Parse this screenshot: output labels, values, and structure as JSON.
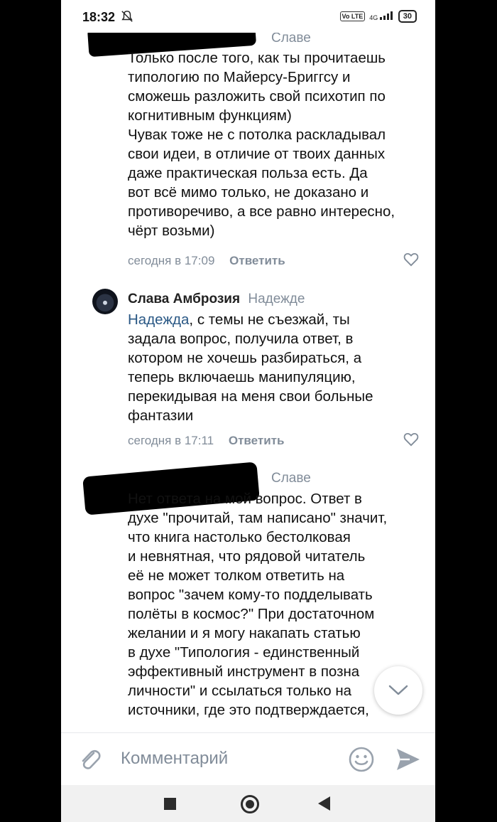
{
  "status_bar": {
    "time": "18:32",
    "volte": "Vo LTE",
    "network": "4G",
    "battery": "30"
  },
  "comments": [
    {
      "author": "",
      "reply_to": "Славе",
      "lines": [
        "Только после того, как ты прочитаешь",
        "типологию по Майерсу-Бриггсу и",
        "сможешь разложить свой психотип по",
        "когнитивным функциям)",
        "Чувак тоже не с потолка раскладывал",
        "свои идеи, в отличие от твоих данных",
        "даже практическая польза есть. Да",
        "вот всё мимо только, не доказано и",
        "противоречиво, а все равно интересно,",
        "чёрт возьми)"
      ],
      "time": "сегодня в 17:09",
      "reply_label": "Ответить"
    },
    {
      "author": "Слава Амброзия",
      "reply_to": "Надежде",
      "mention": "Надежда",
      "first_line_rest": ", с темы не съезжай, ты",
      "lines": [
        "задала вопрос, получила ответ, в",
        "котором не хочешь разбираться, а",
        "теперь включаешь манипуляцию,",
        "перекидывая на меня свои больные",
        "фантазии"
      ],
      "time": "сегодня в 17:11",
      "reply_label": "Ответить"
    },
    {
      "author": "",
      "reply_to": "Славе",
      "lines": [
        "Нет ответа на мой вопрос. Ответ в",
        "духе \"прочитай, там написано\" значит,",
        "что книга настолько бестолковая",
        "и невнятная, что рядовой читатель",
        "её не может толком ответить на",
        "вопрос \"зачем кому-то подделывать",
        "полёты в космос?\" При достаточном",
        "желании и я могу накапать статью",
        "в духе \"Типология - единственный",
        "эффективный инструмент в позна",
        "личности\" и ссылаться только на",
        "источники, где это подтверждается,"
      ]
    }
  ],
  "composer": {
    "placeholder": "Комментарий"
  },
  "colors": {
    "link": "#2a5885",
    "meta": "#818c99",
    "text": "#111111"
  },
  "icons": [
    "mute-bell-icon",
    "heart-icon",
    "chevron-down-icon",
    "paperclip-icon",
    "smile-icon",
    "send-icon"
  ]
}
